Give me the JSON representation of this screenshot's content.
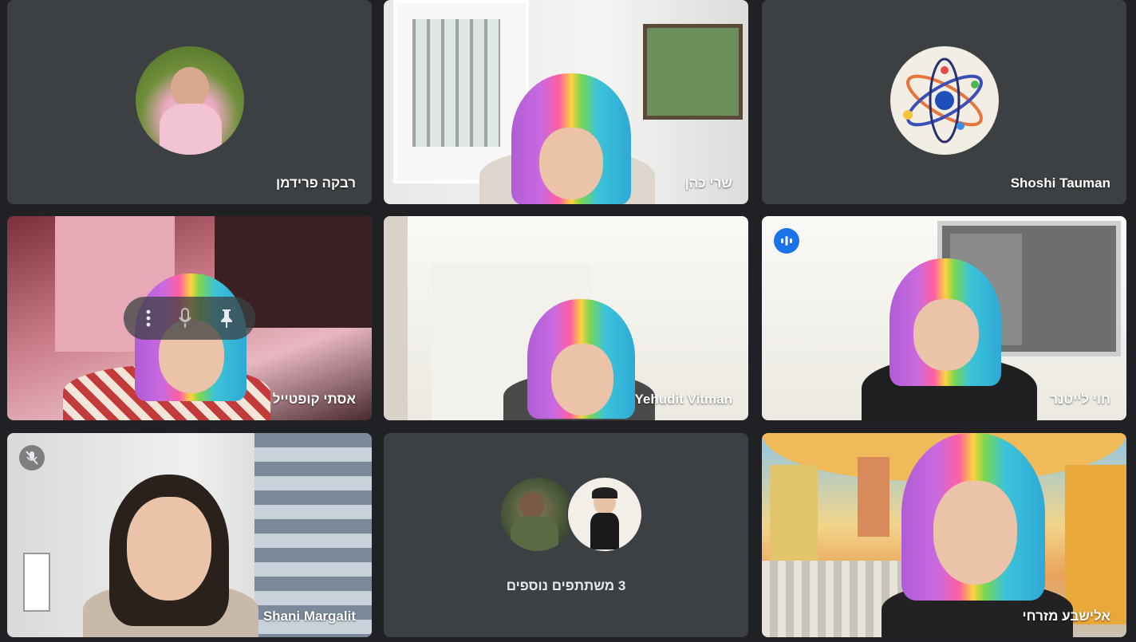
{
  "participants": [
    {
      "name": "רבקה פרידמן",
      "type": "avatar"
    },
    {
      "name": "שרי כהן",
      "type": "video"
    },
    {
      "name": "Shoshi Tauman",
      "type": "avatar"
    },
    {
      "name": "אסתי קופטייל",
      "type": "video"
    },
    {
      "name": "Yehudit Vitman",
      "type": "video"
    },
    {
      "name": "חוי לייטנר",
      "type": "video",
      "speaking": true
    },
    {
      "name": "Shani Margalit",
      "type": "video",
      "muted": true
    },
    {
      "name": "אלישבע מזרחי",
      "type": "video"
    }
  ],
  "more_participants": {
    "label": "3 משתתפים נוספים"
  },
  "colors": {
    "background": "#202124",
    "tile": "#3c4043",
    "active_border": "#8ab4f8",
    "speaking_chip": "#1a73e8"
  },
  "icons": {
    "speaking": "audio-level-icon",
    "muted": "mic-off-icon",
    "more": "more-vert-icon",
    "mic": "mic-icon",
    "pin": "pin-icon"
  }
}
